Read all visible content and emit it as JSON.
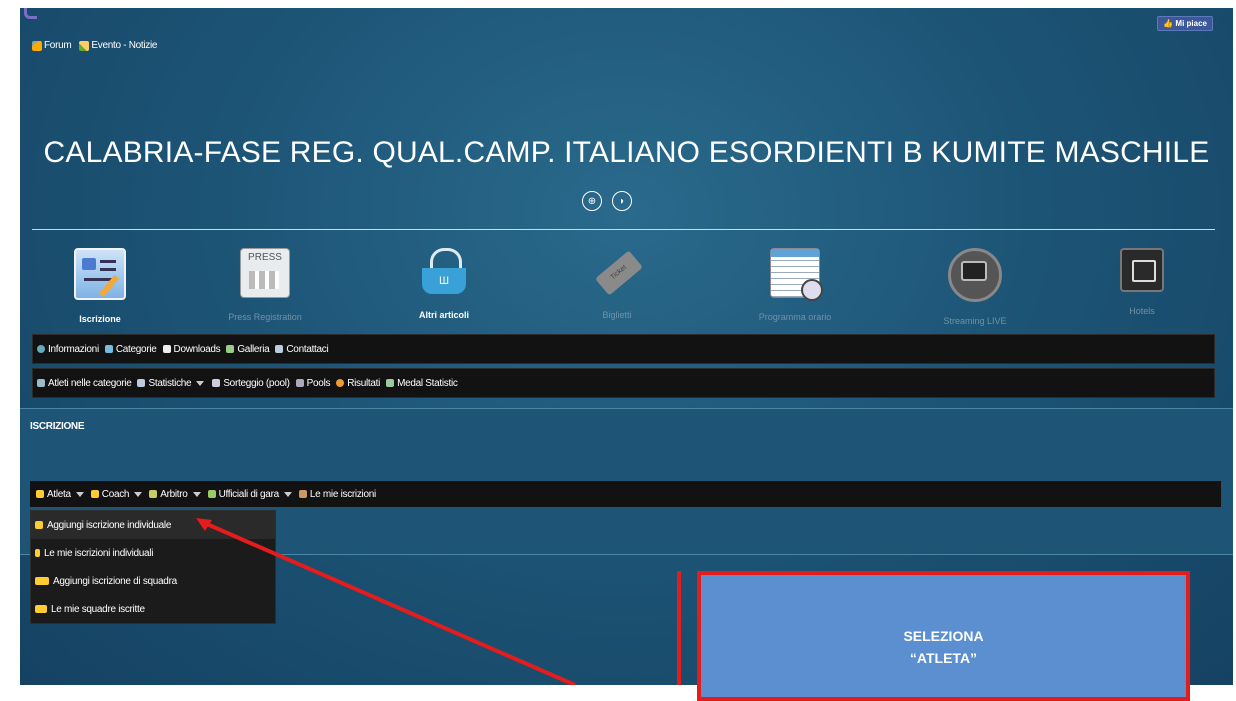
{
  "header": {
    "nav": [
      {
        "label": "Forum",
        "icon": "forum-icon"
      },
      {
        "label": "Evento - Notizie",
        "icon": "news-icon"
      }
    ],
    "like_label": "Mi piace",
    "title": "CALABRIA-FASE REG. QUAL.CAMP. ITALIANO ESORDIENTI B KUMITE MASCHILE"
  },
  "icons": [
    {
      "label": "Iscrizione",
      "icon": "registration-form-icon",
      "active": true
    },
    {
      "label": "Press Registration",
      "icon": "press-icon",
      "active": false
    },
    {
      "label": "Altri articoli",
      "icon": "basket-icon",
      "active": true
    },
    {
      "label": "Biglietti",
      "icon": "ticket-icon",
      "active": false
    },
    {
      "label": "Programma orario",
      "icon": "schedule-icon",
      "active": false
    },
    {
      "label": "Streaming LIVE",
      "icon": "livestream-icon",
      "active": false
    },
    {
      "label": "Hotels",
      "icon": "hotel-icon",
      "active": false
    }
  ],
  "menu1": [
    {
      "label": "Informazioni"
    },
    {
      "label": "Categorie"
    },
    {
      "label": "Downloads"
    },
    {
      "label": "Galleria"
    },
    {
      "label": "Contattaci"
    }
  ],
  "menu2": [
    {
      "label": "Atleti nelle categorie"
    },
    {
      "label": "Statistiche"
    },
    {
      "label": "Sorteggio (pool)"
    },
    {
      "label": "Pools"
    },
    {
      "label": "Risultati"
    },
    {
      "label": "Medal Statistic"
    }
  ],
  "panel": {
    "title": "ISCRIZIONE",
    "menu": [
      {
        "label": "Atleta"
      },
      {
        "label": "Coach"
      },
      {
        "label": "Arbitro"
      },
      {
        "label": "Ufficiali di gara"
      },
      {
        "label": "Le mie iscrizioni"
      }
    ],
    "dropdown": [
      {
        "label": "Aggiungi iscrizione individuale"
      },
      {
        "label": "Le mie iscrizioni individuali"
      },
      {
        "label": "Aggiungi iscrizione di squadra"
      },
      {
        "label": "Le mie squadre iscritte"
      }
    ]
  },
  "callout": {
    "line1": "SELEZIONA",
    "line2": "“ATLETA”"
  },
  "colors": {
    "accent_red": "#e51c1c",
    "callout_bg": "#5b8fd0",
    "background": "#1d5577"
  }
}
